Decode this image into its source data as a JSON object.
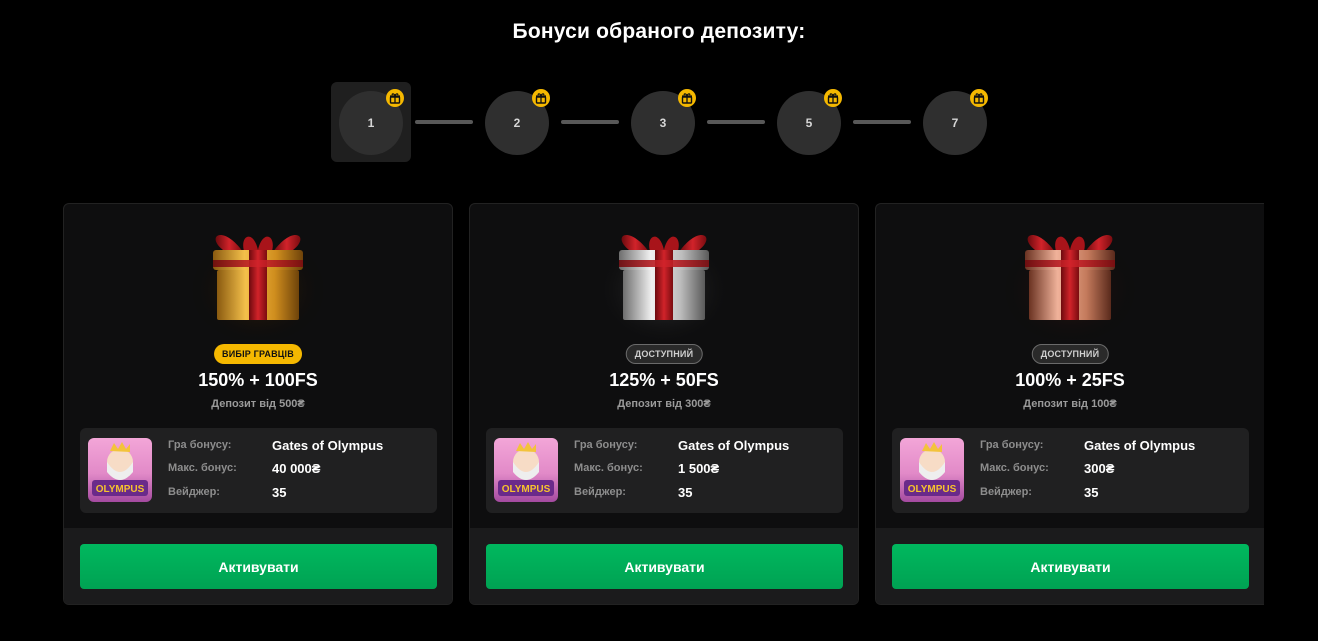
{
  "title": "Бонуси обраного депозиту:",
  "steps": [
    {
      "label": "1",
      "selected": true,
      "icon": "gift-icon"
    },
    {
      "label": "2",
      "selected": false,
      "icon": "gift-icon"
    },
    {
      "label": "3",
      "selected": false,
      "icon": "gift-icon"
    },
    {
      "label": "5",
      "selected": false,
      "icon": "gift-icon"
    },
    {
      "label": "7",
      "selected": false,
      "icon": "gift-icon"
    }
  ],
  "colors": {
    "accent_gold": "#f5b800",
    "button_green": "#00b85e",
    "gift_gold": "#d89a25",
    "gift_silver": "#c9c9c9",
    "gift_bronze": "#c97b5d",
    "ribbon_red": "#b3171c"
  },
  "cards": [
    {
      "gift": "gold-gift",
      "badge": "ВИБІР ГРАВЦІВ",
      "offer": "150% + 100FS",
      "deposit": "Депозит від 500₴",
      "game_label": "Гра бонусу:",
      "game_value": "Gates of Olympus",
      "max_label": "Макс. бонус:",
      "max_value": "40 000₴",
      "wager_label": "Вейджер:",
      "wager_value": "35",
      "thumb_text": "OLYMPUS",
      "button": "Активувати"
    },
    {
      "gift": "silver-gift",
      "badge": "ДОСТУПНИЙ",
      "offer": "125% + 50FS",
      "deposit": "Депозит від 300₴",
      "game_label": "Гра бонусу:",
      "game_value": "Gates of Olympus",
      "max_label": "Макс. бонус:",
      "max_value": "1 500₴",
      "wager_label": "Вейджер:",
      "wager_value": "35",
      "thumb_text": "OLYMPUS",
      "button": "Активувати"
    },
    {
      "gift": "bronze-gift",
      "badge": "ДОСТУПНИЙ",
      "offer": "100% + 25FS",
      "deposit": "Депозит від 100₴",
      "game_label": "Гра бонусу:",
      "game_value": "Gates of Olympus",
      "max_label": "Макс. бонус:",
      "max_value": "300₴",
      "wager_label": "Вейджер:",
      "wager_value": "35",
      "thumb_text": "OLYMPUS",
      "button": "Активувати"
    }
  ]
}
